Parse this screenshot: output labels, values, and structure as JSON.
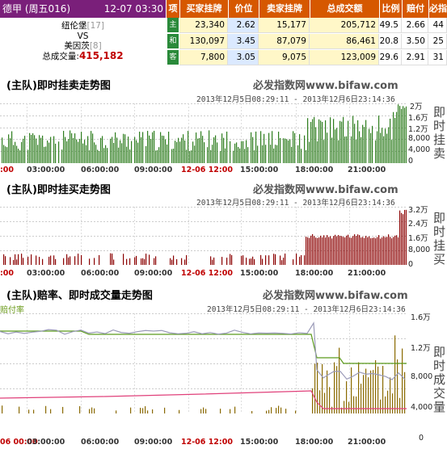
{
  "header": {
    "league": "德甲 (周五016)",
    "datetime": "12-07 03:30",
    "cols": [
      "项",
      "买家挂牌",
      "价位",
      "卖家挂牌",
      "总成交额",
      "比例",
      "赔付率",
      "必指"
    ]
  },
  "match": {
    "home": "纽伦堡",
    "home_rank": "[17]",
    "vs": "VS",
    "away": "美因茨",
    "away_rank": "[8]",
    "total_label": "总成交量:",
    "total_value": "415,182"
  },
  "rows": [
    {
      "tag": "主",
      "buy": "23,340",
      "price": "2.62",
      "sell": "15,177",
      "total": "205,712",
      "ratio": "49.5",
      "payout": "2.66",
      "bf": "44"
    },
    {
      "tag": "和",
      "buy": "130,097",
      "price": "3.45",
      "sell": "87,079",
      "total": "86,461",
      "ratio": "20.8",
      "payout": "3.50",
      "bf": "25"
    },
    {
      "tag": "客",
      "buy": "7,800",
      "price": "3.05",
      "sell": "9,075",
      "total": "123,009",
      "ratio": "29.6",
      "payout": "2.91",
      "bf": "31"
    }
  ],
  "colors": {
    "header_purple": "#7a1f7a",
    "header_orange": "#d65800",
    "tag_green": "#2a8a3a",
    "sell_bar": "#2e7d1e",
    "buy_bar": "#8b0000"
  },
  "panels": {
    "sell": {
      "title": "(主队)即时挂卖走势图",
      "brand": "必发指数网www.bifaw.com",
      "range": "2013年12月5日08:29:11 - 2013年12月6日23:14:36",
      "ylabels": [
        "2万",
        "1.6万",
        "1.2万",
        "8,000",
        "4,000",
        "0"
      ],
      "xlabels": [
        ":00",
        "03:00:00",
        "06:00:00",
        "09:00:00",
        "12-06 12:00",
        "15:00:00",
        "18:00:00",
        "21:00:00"
      ],
      "vtitle": "即时挂卖"
    },
    "buy": {
      "title": "(主队)即时挂买走势图",
      "brand": "必发指数网www.bifaw.com",
      "range": "2013年12月5日08:29:11 - 2013年12月6日23:14:36",
      "ylabels": [
        "3.2万",
        "2.4万",
        "1.6万",
        "8,000",
        "0"
      ],
      "xlabels": [
        ":00",
        "03:00:00",
        "06:00:00",
        "09:00:00",
        "12-06 12:00",
        "15:00:00",
        "18:00:00",
        "21:00:00"
      ],
      "vtitle": "即时挂买"
    },
    "odds": {
      "title": "(主队)赔率、即时成交量走势图",
      "brand": "必发指数网www.bifaw.com",
      "legend": "赔付率",
      "range": "2013年12月5日08:29:11 - 2013年12月6日23:14:36",
      "ylabels": [
        "1.6万",
        "1.2万",
        "8,000",
        "4,000",
        "0"
      ],
      "xlabels": [
        "06 00:00",
        "03:00:00",
        "06:00:00",
        "09:00:00",
        "12-06 12:00",
        "15:00:00",
        "18:00:00",
        "21:00:00"
      ],
      "vtitle": "即时成交量"
    }
  }
}
